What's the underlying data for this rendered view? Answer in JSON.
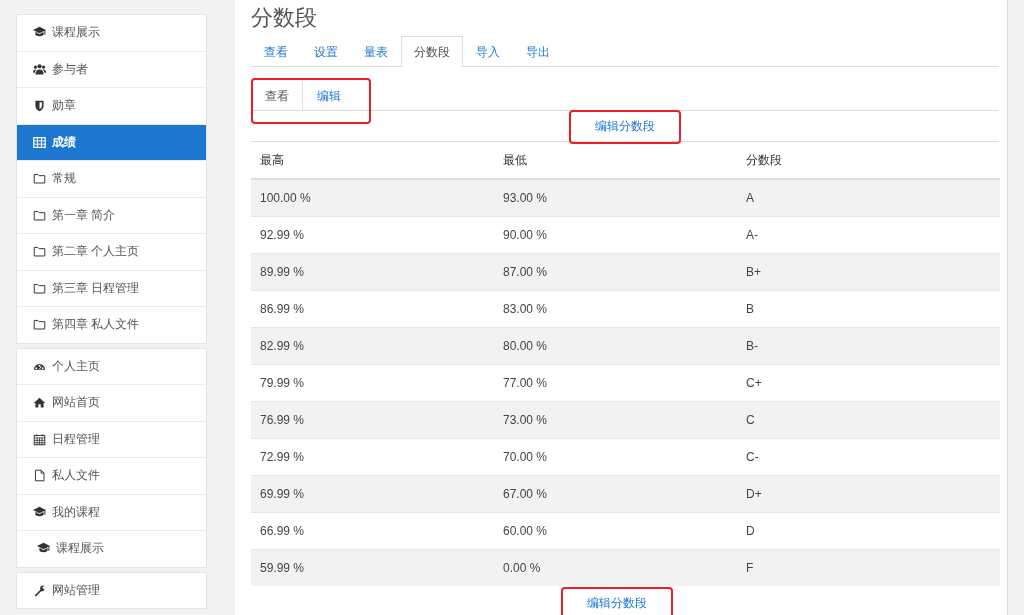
{
  "sidebar": {
    "groups": [
      {
        "items": [
          {
            "label": "课程展示",
            "kind": "cap",
            "selected": false,
            "indented": false
          },
          {
            "label": "参与者",
            "kind": "users",
            "selected": false,
            "indented": false
          },
          {
            "label": "勋章",
            "kind": "shield",
            "selected": false,
            "indented": false
          },
          {
            "label": "成绩",
            "kind": "table",
            "selected": true,
            "indented": false
          },
          {
            "label": "常规",
            "kind": "folder",
            "selected": false,
            "indented": false
          },
          {
            "label": "第一章 简介",
            "kind": "folder",
            "selected": false,
            "indented": false
          },
          {
            "label": "第二章 个人主页",
            "kind": "folder",
            "selected": false,
            "indented": false
          },
          {
            "label": "第三章 日程管理",
            "kind": "folder",
            "selected": false,
            "indented": false
          },
          {
            "label": "第四章 私人文件",
            "kind": "folder",
            "selected": false,
            "indented": false
          }
        ]
      },
      {
        "items": [
          {
            "label": "个人主页",
            "kind": "dashboard",
            "selected": false,
            "indented": false
          },
          {
            "label": "网站首页",
            "kind": "home",
            "selected": false,
            "indented": false
          },
          {
            "label": "日程管理",
            "kind": "calendar",
            "selected": false,
            "indented": false
          },
          {
            "label": "私人文件",
            "kind": "file",
            "selected": false,
            "indented": false
          },
          {
            "label": "我的课程",
            "kind": "cap",
            "selected": false,
            "indented": false
          },
          {
            "label": "课程展示",
            "kind": "cap",
            "selected": false,
            "indented": true
          }
        ]
      },
      {
        "items": [
          {
            "label": "网站管理",
            "kind": "wrench",
            "selected": false,
            "indented": false
          }
        ]
      }
    ]
  },
  "page_title": "分数段",
  "tabs": [
    {
      "label": "查看",
      "selected": false
    },
    {
      "label": "设置",
      "selected": false
    },
    {
      "label": "量表",
      "selected": false
    },
    {
      "label": "分数段",
      "selected": true
    },
    {
      "label": "导入",
      "selected": false
    },
    {
      "label": "导出",
      "selected": false
    }
  ],
  "subtabs": {
    "highlighted": true,
    "items": [
      {
        "label": "查看",
        "selected": true
      },
      {
        "label": "编辑",
        "selected": false
      }
    ]
  },
  "edit_link_top": {
    "label": "编辑分数段",
    "highlighted": true
  },
  "table": {
    "columns": [
      "最高",
      "最低",
      "分数段"
    ],
    "rows": [
      [
        "100.00 %",
        "93.00 %",
        "A"
      ],
      [
        "92.99 %",
        "90.00 %",
        "A-"
      ],
      [
        "89.99 %",
        "87.00 %",
        "B+"
      ],
      [
        "86.99 %",
        "83.00 %",
        "B"
      ],
      [
        "82.99 %",
        "80.00 %",
        "B-"
      ],
      [
        "79.99 %",
        "77.00 %",
        "C+"
      ],
      [
        "76.99 %",
        "73.00 %",
        "C"
      ],
      [
        "72.99 %",
        "70.00 %",
        "C-"
      ],
      [
        "69.99 %",
        "67.00 %",
        "D+"
      ],
      [
        "66.99 %",
        "60.00 %",
        "D"
      ],
      [
        "59.99 %",
        "0.00 %",
        "F"
      ]
    ]
  },
  "edit_link_bottom": {
    "label": "编辑分数段",
    "highlighted": true
  }
}
